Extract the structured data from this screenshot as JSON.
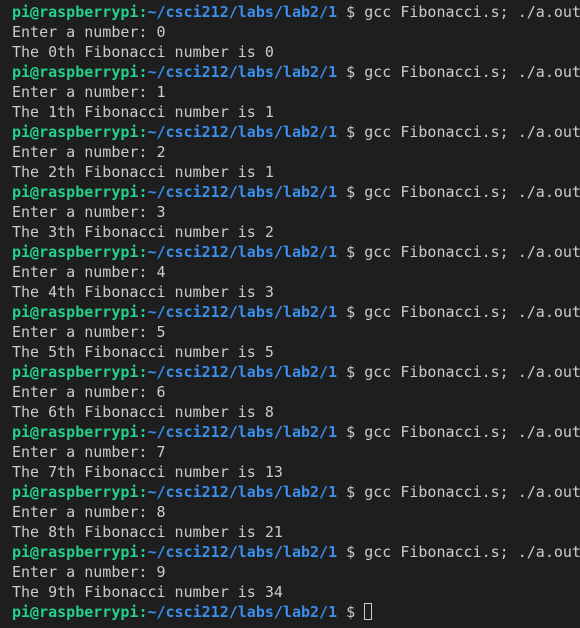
{
  "prompt": {
    "user_host": "pi@raspberrypi",
    "separator": ":",
    "path": "~/csci212/labs/lab2/1",
    "symbol": " $ "
  },
  "lines": [
    {
      "type": "prompt",
      "command": "gcc Fibonacci.s; ./a.out"
    },
    {
      "type": "output",
      "text": "Enter a number: 0"
    },
    {
      "type": "output",
      "text": "The 0th Fibonacci number is 0"
    },
    {
      "type": "prompt",
      "command": "gcc Fibonacci.s; ./a.out"
    },
    {
      "type": "output",
      "text": "Enter a number: 1"
    },
    {
      "type": "output",
      "text": "The 1th Fibonacci number is 1"
    },
    {
      "type": "prompt",
      "command": "gcc Fibonacci.s; ./a.out"
    },
    {
      "type": "output",
      "text": "Enter a number: 2"
    },
    {
      "type": "output",
      "text": "The 2th Fibonacci number is 1"
    },
    {
      "type": "prompt",
      "command": "gcc Fibonacci.s; ./a.out"
    },
    {
      "type": "output",
      "text": "Enter a number: 3"
    },
    {
      "type": "output",
      "text": "The 3th Fibonacci number is 2"
    },
    {
      "type": "prompt",
      "command": "gcc Fibonacci.s; ./a.out"
    },
    {
      "type": "output",
      "text": "Enter a number: 4"
    },
    {
      "type": "output",
      "text": "The 4th Fibonacci number is 3"
    },
    {
      "type": "prompt",
      "command": "gcc Fibonacci.s; ./a.out"
    },
    {
      "type": "output",
      "text": "Enter a number: 5"
    },
    {
      "type": "output",
      "text": "The 5th Fibonacci number is 5"
    },
    {
      "type": "prompt",
      "command": "gcc Fibonacci.s; ./a.out"
    },
    {
      "type": "output",
      "text": "Enter a number: 6"
    },
    {
      "type": "output",
      "text": "The 6th Fibonacci number is 8"
    },
    {
      "type": "prompt",
      "command": "gcc Fibonacci.s; ./a.out"
    },
    {
      "type": "output",
      "text": "Enter a number: 7"
    },
    {
      "type": "output",
      "text": "The 7th Fibonacci number is 13"
    },
    {
      "type": "prompt",
      "command": "gcc Fibonacci.s; ./a.out"
    },
    {
      "type": "output",
      "text": "Enter a number: 8"
    },
    {
      "type": "output",
      "text": "The 8th Fibonacci number is 21"
    },
    {
      "type": "prompt",
      "command": "gcc Fibonacci.s; ./a.out"
    },
    {
      "type": "output",
      "text": "Enter a number: 9"
    },
    {
      "type": "output",
      "text": "The 9th Fibonacci number is 34"
    },
    {
      "type": "prompt",
      "command": ""
    }
  ],
  "cursor": {
    "shape": "block-outline"
  },
  "colors": {
    "background": "#1e1e1e",
    "foreground": "#cccccc",
    "user_host": "#23d18b",
    "path": "#3b8eea"
  }
}
